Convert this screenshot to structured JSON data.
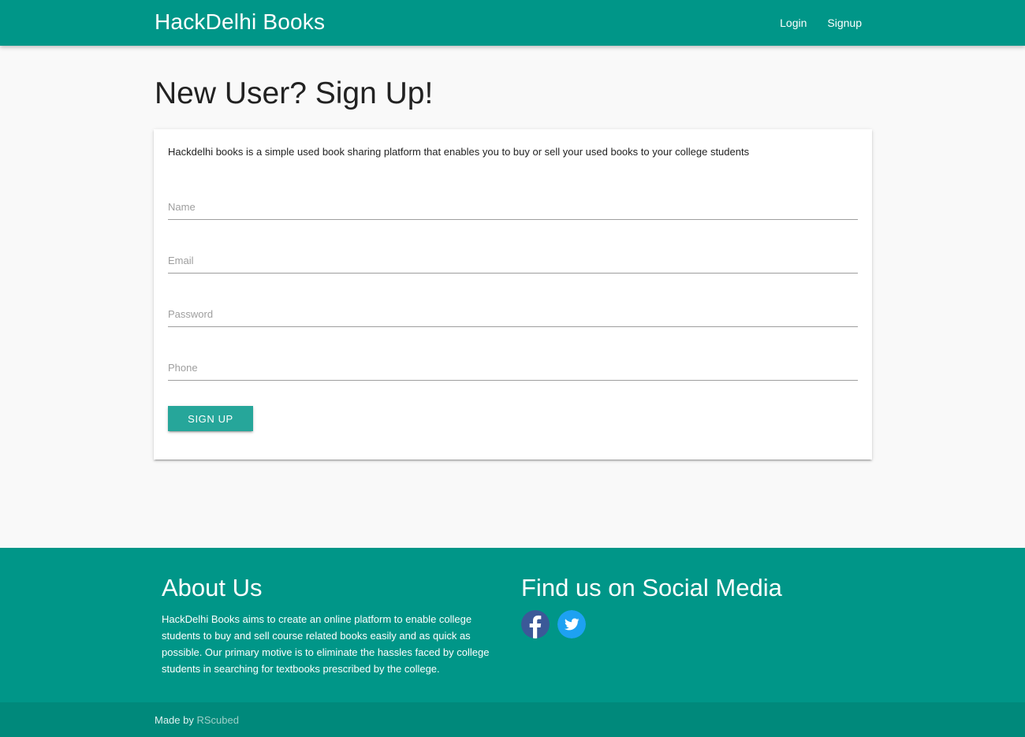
{
  "navbar": {
    "brand": "HackDelhi Books",
    "links": [
      "Login",
      "Signup"
    ]
  },
  "page": {
    "title": "New User? Sign Up!"
  },
  "form": {
    "intro": "Hackdelhi books is a simple used book sharing platform that enables you to buy or sell your used books to your college students",
    "fields": {
      "name": {
        "placeholder": "Name",
        "value": ""
      },
      "email": {
        "placeholder": "Email",
        "value": ""
      },
      "password": {
        "placeholder": "Password",
        "value": ""
      },
      "phone": {
        "placeholder": "Phone",
        "value": ""
      }
    },
    "submit_label": "SIGN UP"
  },
  "footer": {
    "about_title": "About Us",
    "about_text": "HackDelhi Books aims to create an online platform to enable college students to buy and sell course related books easily and as quick as possible. Our primary motive is to eliminate the hassles faced by college students in searching for textbooks prescribed by the college.",
    "social_title": "Find us on Social Media",
    "social": [
      "facebook-icon",
      "twitter-icon"
    ],
    "made_by_prefix": "Made by",
    "made_by_link": "RScubed"
  },
  "colors": {
    "primary": "#009688",
    "button": "#26a69a",
    "footer_bottom": "#00897b",
    "facebook": "#3b5998",
    "twitter": "#1da1f2"
  }
}
